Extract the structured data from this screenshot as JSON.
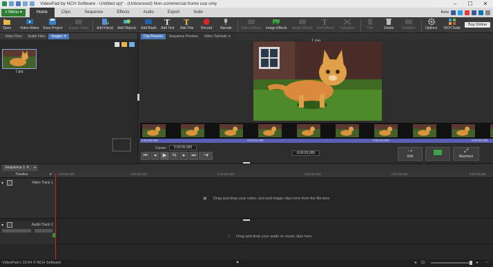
{
  "window": {
    "title": "VideoPad by NCH Software - Untitled.vpj* - (Unlicensed) Non-commercial home use only"
  },
  "menu_label": "Menu",
  "ribbon_tabs": [
    "Home",
    "Clips",
    "Sequence",
    "Effects",
    "Audio",
    "Export",
    "Suite"
  ],
  "ribbon_active": "Home",
  "beta_label": "Beta",
  "toolbar": {
    "open": "Open",
    "video_maker": "Video Maker",
    "save_project": "Save Project",
    "export_video": "Export Video",
    "add_files": "Add File(s)",
    "add_objects": "Add Objects",
    "add_blank": "Add Blank",
    "add_text": "Add Text",
    "add_title": "Add Title",
    "record": "Record",
    "narrate": "Narrate",
    "video_effects": "Video Effects",
    "image_effects": "Image Effects",
    "audio_effects": "Audio Effects",
    "text_effects": "Text Effects",
    "transition": "Transition",
    "trim": "Trim",
    "delete": "Delete",
    "subtitles": "Subtitles",
    "options": "Options",
    "nch_suite": "NCH Suite",
    "buy_online": "Buy Online"
  },
  "bin_tabs": [
    "Video Files",
    "Audio Files",
    "Images"
  ],
  "bin_active": "Images",
  "bin_items": [
    {
      "caption": "1.jpg"
    }
  ],
  "preview_tabs": [
    "Clip Preview",
    "Sequence Preview",
    "Video Tutorials"
  ],
  "preview_active": "Clip Preview",
  "preview_filename": "1.jpg",
  "film_times": [
    "0:00:00.000",
    "0:00:01.000",
    "0:00:02.000",
    "0:00:03.000"
  ],
  "cursor_label": "Cursor:",
  "cursor_value": "0:00:00.000",
  "duration_value": "0:00:03.000",
  "add_label": "Add",
  "maximize_label": "Maximize",
  "sequence_tab": "Sequence 1",
  "timeline_label": "Timeline",
  "ruler_times": [
    "0:00:00.000",
    "0:01:00.000",
    "0:02:00.000",
    "0:03:00.000",
    "0:04:00.000",
    "0:05:00.000"
  ],
  "video_track": {
    "label": "Video Track 1",
    "hint": "Drag and drop your video, text and image clips here from the file bins"
  },
  "audio_track": {
    "label": "Audio Track 1",
    "hint": "Drag and drop your audio or music clips here"
  },
  "status_text": "VideoPad v 10.54 © NCH Software",
  "colors": {
    "accent": "#4a78b8",
    "menu_green": "#2e7d32",
    "playhead": "#e02020",
    "filmbar": "#5a5fb5"
  }
}
